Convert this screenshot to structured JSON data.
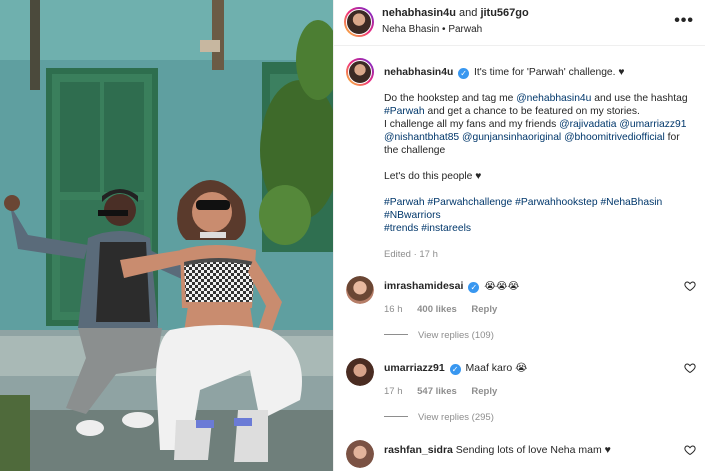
{
  "post": {
    "header_user": "nehabhasin4u",
    "header_and": " and ",
    "header_collab": "jitu567go",
    "audio_artist": "Neha Bhasin",
    "audio_dot": " • ",
    "audio_song": "Parwah",
    "more_label": "•••"
  },
  "caption": {
    "user": "nehabhasin4u",
    "verified_glyph": "✓",
    "lines": {
      "l1": "It's time for 'Parwah' challenge. ♥",
      "l2a": "Do the hookstep and tag me ",
      "l2b": "@nehabhasin4u",
      "l2c": " and use the hashtag",
      "l3a": "#Parwah",
      "l3b": " and get a chance to be featured on my stories.",
      "l4a": "I challenge all my fans and my friends ",
      "l4b": "@rajivadatia",
      "l4c": " ",
      "l4d": "@umarriazz91",
      "l5a": "@nishantbhat85",
      "l5b": " ",
      "l5c": "@gunjansinhaoriginal",
      "l5d": " ",
      "l5e": "@bhoomitrivediofficial",
      "l5f": " for",
      "l6": "the challenge",
      "l7": "Let's do this people ♥",
      "l8a": "#Parwah",
      "l8b": "#Parwahchallenge",
      "l8c": "#Parwahhookstep",
      "l8d": "#NehaBhasin",
      "l9": "#NBwarriors",
      "l10a": "#trends",
      "l10b": "#instareels"
    },
    "edited": "Edited · 17 h"
  },
  "comments": [
    {
      "user": "imrashamidesai",
      "verified_glyph": "✓",
      "text": "😭😭😭",
      "age": "16 h",
      "likes": "400 likes",
      "reply": "Reply",
      "view_replies": "View replies (109)"
    },
    {
      "user": "umarriazz91",
      "verified_glyph": "✓",
      "text": "Maaf karo 😭",
      "age": "17 h",
      "likes": "547 likes",
      "reply": "Reply",
      "view_replies": "View replies (295)"
    },
    {
      "user": "rashfan_sidra",
      "text": "Sending lots of love Neha mam ♥"
    }
  ],
  "colors": {
    "link": "#00376b",
    "verified": "#3897f0",
    "muted": "#8e8e8e"
  }
}
